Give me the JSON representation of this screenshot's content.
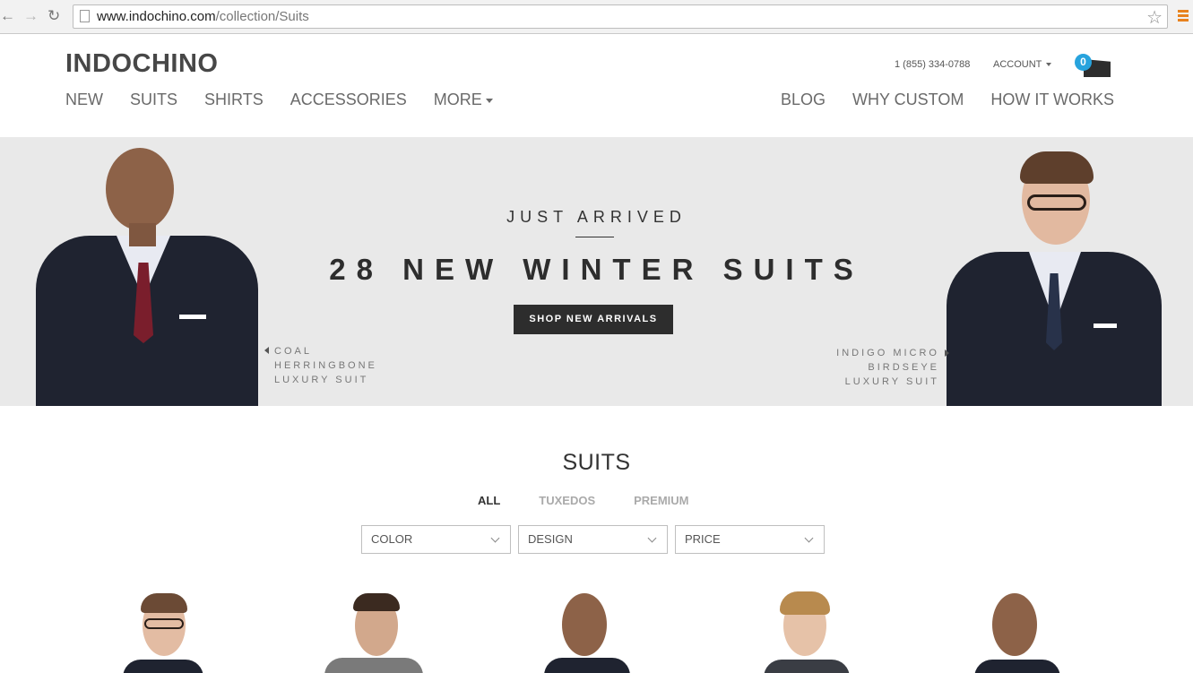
{
  "browser": {
    "back_icon": "back-arrow-icon",
    "forward_icon": "forward-arrow-icon",
    "reload_icon": "reload-icon",
    "url_host": "www.indochino.com",
    "url_path": "/collection/Suits",
    "bookmark_icon": "star-icon",
    "menu_icon": "hamburger-menu-icon"
  },
  "header": {
    "logo": "INDOCHINO",
    "phone": "1 (855) 334-0788",
    "account": "ACCOUNT",
    "cart_count": "0",
    "main_nav": [
      "NEW",
      "SUITS",
      "SHIRTS",
      "ACCESSORIES",
      "MORE"
    ],
    "right_nav": [
      "BLOG",
      "WHY CUSTOM",
      "HOW IT WORKS"
    ]
  },
  "hero": {
    "kicker": "JUST ARRIVED",
    "title": "28 NEW WINTER SUITS",
    "button": "SHOP NEW ARRIVALS",
    "left_caption": [
      "COAL",
      "HERRINGBONE",
      "LUXURY SUIT"
    ],
    "right_caption": [
      "INDIGO MICRO",
      "BIRDSEYE",
      "LUXURY SUIT"
    ]
  },
  "collection": {
    "title": "SUITS",
    "tabs": [
      "ALL",
      "TUXEDOS",
      "PREMIUM"
    ],
    "active_tab": "ALL",
    "filters": [
      "COLOR",
      "DESIGN",
      "PRICE"
    ]
  },
  "colors": {
    "accent_blue": "#27a3dd",
    "button_dark": "#2d2d2d",
    "hero_bg": "#e9e9e9"
  }
}
